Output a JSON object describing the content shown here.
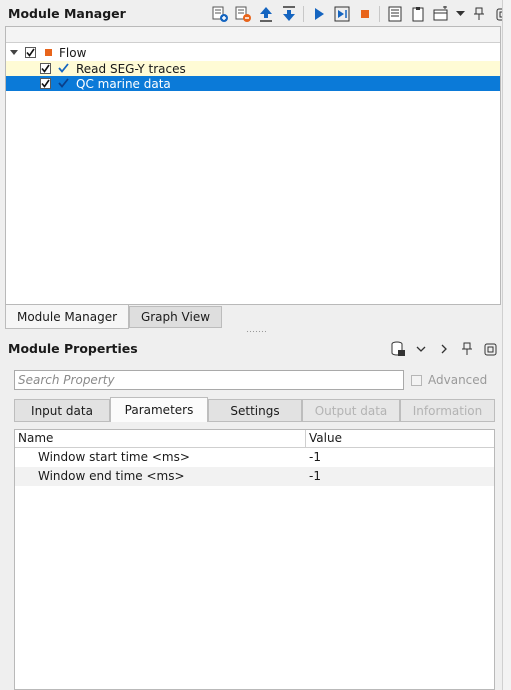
{
  "module_manager": {
    "title": "Module Manager",
    "toolbar_icons": [
      "add-module-icon",
      "remove-module-icon",
      "move-up-icon",
      "move-down-icon",
      "run-icon",
      "run-step-icon",
      "stop-icon",
      "list-icon",
      "clipboard-icon",
      "window-options-icon",
      "dropdown-icon",
      "pin-icon",
      "float-icon"
    ],
    "tree": {
      "root": {
        "label": "Flow",
        "checked": true
      },
      "items": [
        {
          "label": "Read SEG-Y traces",
          "checked": true,
          "status": "done"
        },
        {
          "label": "QC marine data",
          "checked": true,
          "status": "done"
        }
      ]
    },
    "tabs": [
      "Module Manager",
      "Graph View"
    ],
    "active_tab": "Module Manager"
  },
  "module_properties": {
    "title": "Module Properties",
    "search": {
      "placeholder": "Search Property",
      "value": ""
    },
    "advanced_label": "Advanced",
    "tabs": [
      "Input data",
      "Parameters",
      "Settings",
      "Output data",
      "Information"
    ],
    "active_tab": "Parameters",
    "table": {
      "headers": [
        "Name",
        "Value"
      ],
      "rows": [
        {
          "name": "Window start time <ms>",
          "value": "-1"
        },
        {
          "name": "Window end time <ms>",
          "value": "-1"
        }
      ]
    }
  },
  "colors": {
    "selection": "#0b7ad8",
    "highlight_row": "#fffbd5",
    "accent_blue": "#1565c0",
    "accent_orange": "#e8641b"
  }
}
